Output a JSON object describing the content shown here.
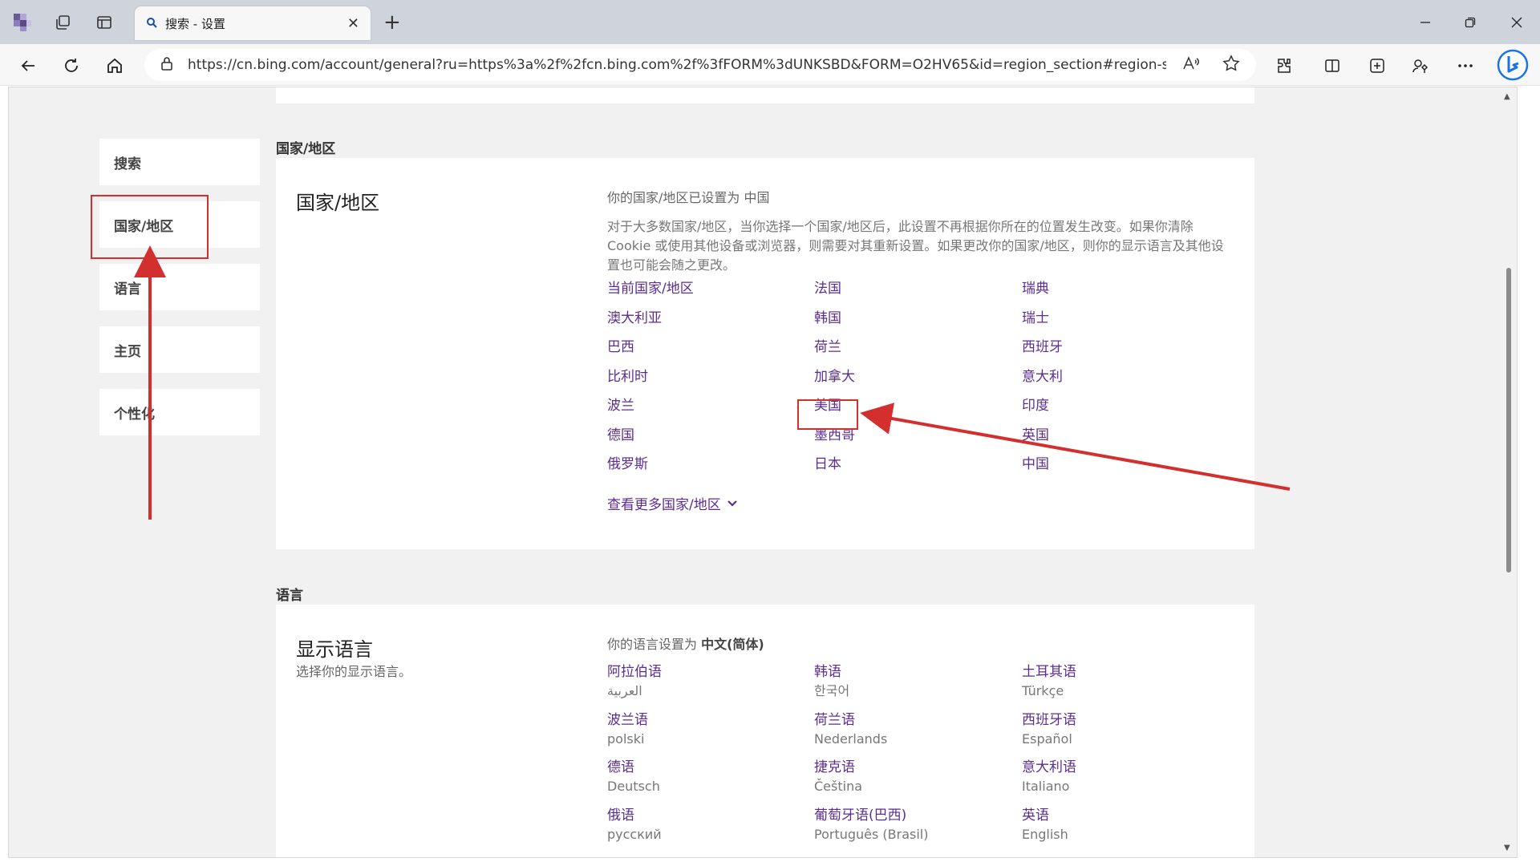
{
  "browser": {
    "tab_title": "搜索 - 设置",
    "url": "https://cn.bing.com/account/general?ru=https%3a%2f%2fcn.bing.com%2f%3fFORM%3dUNKSBD&FORM=O2HV65&id=region_section#region-section"
  },
  "sidebar": {
    "items": [
      {
        "label": "搜索"
      },
      {
        "label": "国家/地区"
      },
      {
        "label": "语言"
      },
      {
        "label": "主页"
      },
      {
        "label": "个性化"
      }
    ]
  },
  "region": {
    "section_heading": "国家/地区",
    "title": "国家/地区",
    "current_label": "你的国家/地区已设置为 中国",
    "description": "对于大多数国家/地区，当你选择一个国家/地区后，此设置不再根据你所在的位置发生改变。如果你清除 Cookie 或使用其他设备或浏览器，则需要对其重新设置。如果更改你的国家/地区，则你的显示语言及其他设置也可能会随之更改。",
    "options": [
      [
        "当前国家/地区",
        "法国",
        "瑞典"
      ],
      [
        "澳大利亚",
        "韩国",
        "瑞士"
      ],
      [
        "巴西",
        "荷兰",
        "西班牙"
      ],
      [
        "比利时",
        "加拿大",
        "意大利"
      ],
      [
        "波兰",
        "美国",
        "印度"
      ],
      [
        "德国",
        "墨西哥",
        "英国"
      ],
      [
        "俄罗斯",
        "日本",
        "中国"
      ]
    ],
    "more_label": "查看更多国家/地区"
  },
  "language": {
    "section_heading": "语言",
    "title": "显示语言",
    "subtitle": "选择你的显示语言。",
    "current_prefix": "你的语言设置为 ",
    "current_value": "中文(简体)",
    "options": [
      [
        {
          "name": "阿拉伯语",
          "native": "العربية"
        },
        {
          "name": "韩语",
          "native": "한국어"
        },
        {
          "name": "土耳其语",
          "native": "Türkçe"
        }
      ],
      [
        {
          "name": "波兰语",
          "native": "polski"
        },
        {
          "name": "荷兰语",
          "native": "Nederlands"
        },
        {
          "name": "西班牙语",
          "native": "Español"
        }
      ],
      [
        {
          "name": "德语",
          "native": "Deutsch"
        },
        {
          "name": "捷克语",
          "native": "Čeština"
        },
        {
          "name": "意大利语",
          "native": "Italiano"
        }
      ],
      [
        {
          "name": "俄语",
          "native": "русский"
        },
        {
          "name": "葡萄牙语(巴西)",
          "native": "Português (Brasil)"
        },
        {
          "name": "英语",
          "native": "English"
        }
      ]
    ]
  },
  "colors": {
    "link": "#5b2d91",
    "annotation": "#d32f2f"
  }
}
